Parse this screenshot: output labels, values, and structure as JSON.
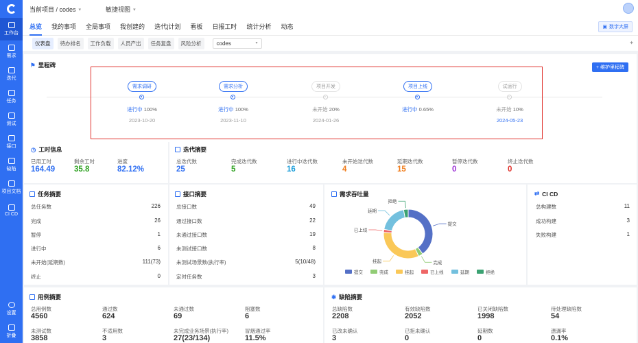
{
  "nav": {
    "workbench": "工作台",
    "demand": "需求",
    "iteration": "迭代",
    "task": "任务",
    "test": "测试",
    "api": "接口",
    "defect": "缺陷",
    "docs": "项目文档",
    "cicd": "CI CD",
    "settings": "设置",
    "collapse": "折叠"
  },
  "topbar": {
    "breadcrumb": "当前项目 / codes",
    "view": "敏捷视图"
  },
  "tabs": [
    "总览",
    "我的事项",
    "全局事项",
    "我创建的",
    "迭代|计划",
    "看板",
    "日报工时",
    "统计分析",
    "动态"
  ],
  "bigscreen_label": "数字大屏",
  "subtabs": [
    "仪表盘",
    "待办排名",
    "工作负载",
    "人员产出",
    "任务复盘",
    "风险分析"
  ],
  "project_select": "codes",
  "milestone": {
    "title": "里程碑",
    "add_label": "+ 维护里程碑",
    "items": [
      {
        "name": "需求调研",
        "status": "进行中",
        "pct": "100%",
        "date": "2023-10-20"
      },
      {
        "name": "需求分析",
        "status": "进行中",
        "pct": "100%",
        "date": "2023-11-10"
      },
      {
        "name": "项目开发",
        "status": "未开始",
        "pct": "20%",
        "date": "2024-01-26"
      },
      {
        "name": "项目上线",
        "status": "进行中",
        "pct": "0.65%",
        "date": ""
      },
      {
        "name": "试运行",
        "status": "未开始",
        "pct": "10%",
        "date": "2024-05-23"
      }
    ]
  },
  "worktime": {
    "title": "工时信息",
    "labels": [
      "已用工时",
      "剩余工时",
      "进度"
    ],
    "values": [
      "164.49",
      "35.8",
      "82.12%"
    ]
  },
  "iteration_summary": {
    "title": "迭代摘要",
    "labels": [
      "总迭代数",
      "完成迭代数",
      "进行中迭代数",
      "未开始迭代数",
      "延期迭代数",
      "暂停迭代数",
      "终止迭代数"
    ],
    "values": [
      "25",
      "5",
      "16",
      "4",
      "15",
      "0",
      "0"
    ]
  },
  "task_summary": {
    "title": "任务摘要",
    "rows": [
      [
        "总任务数",
        "226"
      ],
      [
        "完成",
        "26"
      ],
      [
        "暂停",
        "1"
      ],
      [
        "进行中",
        "6"
      ],
      [
        "未开始(延期数)",
        "111(73)"
      ],
      [
        "终止",
        "0"
      ]
    ]
  },
  "api_summary": {
    "title": "接口摘要",
    "rows": [
      [
        "总接口数",
        "49"
      ],
      [
        "通过接口数",
        "22"
      ],
      [
        "未通过接口数",
        "19"
      ],
      [
        "未测试接口数",
        "8"
      ],
      [
        "未测试场景数(执行率)",
        "5(10/48)"
      ],
      [
        "定时任务数",
        "3"
      ]
    ]
  },
  "throughput": {
    "title": "需求吞吐量"
  },
  "cicd": {
    "title": "CI CD",
    "rows": [
      [
        "总构建数",
        "11"
      ],
      [
        "成功构建",
        "3"
      ],
      [
        "失败构建",
        "1"
      ]
    ]
  },
  "case_summary": {
    "title": "用例摘要",
    "labels": [
      "总用例数",
      "通过数",
      "未通过数",
      "阻塞数",
      "未测试数",
      "不适用数",
      "未完成业务场景(执行率)",
      "冒烟通过率"
    ],
    "values": [
      "4560",
      "624",
      "69",
      "6",
      "3858",
      "3",
      "27(23/134)",
      "11.5%"
    ]
  },
  "defect_summary": {
    "title": "缺陷摘要",
    "labels": [
      "总缺陷数",
      "有效缺陷数",
      "已关闭缺陷数",
      "待处理缺陷数",
      "已改未确认",
      "已拒未确认",
      "延期数",
      "遗漏率"
    ],
    "values": [
      "2208",
      "2052",
      "1998",
      "54",
      "3",
      "0",
      "0",
      "0.1%"
    ]
  },
  "chart_data": {
    "type": "pie",
    "series": [
      {
        "name": "提交",
        "value": 40,
        "color": "#5470c6"
      },
      {
        "name": "完成",
        "value": 3,
        "color": "#91cc75"
      },
      {
        "name": "挂起",
        "value": 33,
        "color": "#fac858"
      },
      {
        "name": "已上线",
        "value": 2,
        "color": "#ee6666"
      },
      {
        "name": "延期",
        "value": 19,
        "color": "#73c0de"
      },
      {
        "name": "拒绝",
        "value": 3,
        "color": "#3ba272"
      }
    ],
    "slice_labels": [
      "拒绝",
      "延期",
      "已上线",
      "挂起",
      "完成",
      "提交"
    ],
    "legend": [
      "提交",
      "完成",
      "挂起",
      "已上线",
      "延期",
      "拒绝"
    ],
    "legend_position": "bottom"
  }
}
